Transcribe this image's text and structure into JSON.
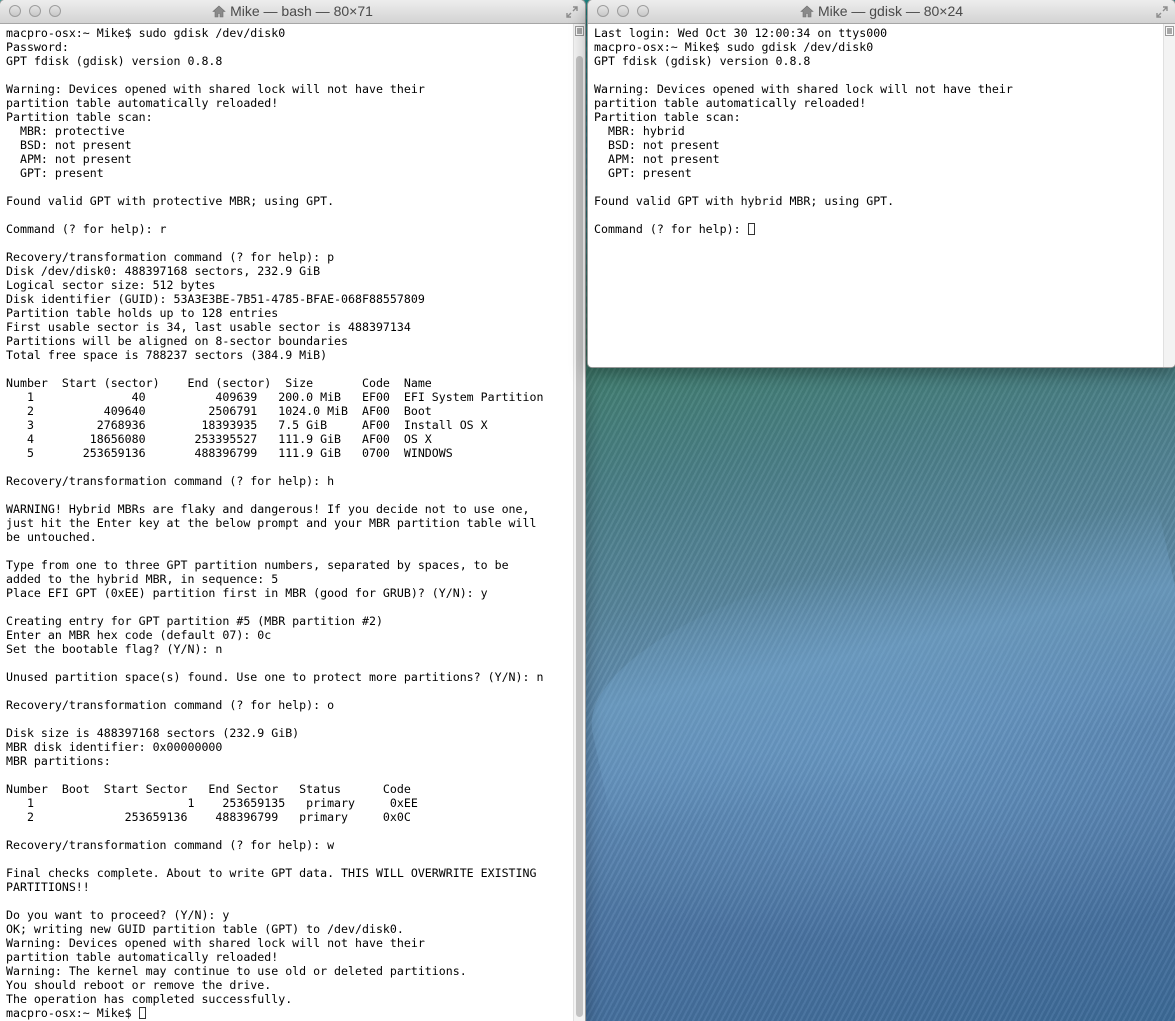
{
  "left_window": {
    "title": "Mike — bash — 80×71",
    "lines": [
      "macpro-osx:~ Mike$ sudo gdisk /dev/disk0",
      "Password:",
      "GPT fdisk (gdisk) version 0.8.8",
      "",
      "Warning: Devices opened with shared lock will not have their",
      "partition table automatically reloaded!",
      "Partition table scan:",
      "  MBR: protective",
      "  BSD: not present",
      "  APM: not present",
      "  GPT: present",
      "",
      "Found valid GPT with protective MBR; using GPT.",
      "",
      "Command (? for help): r",
      "",
      "Recovery/transformation command (? for help): p",
      "Disk /dev/disk0: 488397168 sectors, 232.9 GiB",
      "Logical sector size: 512 bytes",
      "Disk identifier (GUID): 53A3E3BE-7B51-4785-BFAE-068F88557809",
      "Partition table holds up to 128 entries",
      "First usable sector is 34, last usable sector is 488397134",
      "Partitions will be aligned on 8-sector boundaries",
      "Total free space is 788237 sectors (384.9 MiB)",
      "",
      "Number  Start (sector)    End (sector)  Size       Code  Name",
      "   1              40          409639   200.0 MiB   EF00  EFI System Partition",
      "   2          409640         2506791   1024.0 MiB  AF00  Boot",
      "   3         2768936        18393935   7.5 GiB     AF00  Install OS X",
      "   4        18656080       253395527   111.9 GiB   AF00  OS X",
      "   5       253659136       488396799   111.9 GiB   0700  WINDOWS",
      "",
      "Recovery/transformation command (? for help): h",
      "",
      "WARNING! Hybrid MBRs are flaky and dangerous! If you decide not to use one,",
      "just hit the Enter key at the below prompt and your MBR partition table will",
      "be untouched.",
      "",
      "Type from one to three GPT partition numbers, separated by spaces, to be",
      "added to the hybrid MBR, in sequence: 5",
      "Place EFI GPT (0xEE) partition first in MBR (good for GRUB)? (Y/N): y",
      "",
      "Creating entry for GPT partition #5 (MBR partition #2)",
      "Enter an MBR hex code (default 07): 0c",
      "Set the bootable flag? (Y/N): n",
      "",
      "Unused partition space(s) found. Use one to protect more partitions? (Y/N): n",
      "",
      "Recovery/transformation command (? for help): o",
      "",
      "Disk size is 488397168 sectors (232.9 GiB)",
      "MBR disk identifier: 0x00000000",
      "MBR partitions:",
      "",
      "Number  Boot  Start Sector   End Sector   Status      Code",
      "   1                      1    253659135   primary     0xEE",
      "   2             253659136    488396799   primary     0x0C",
      "",
      "Recovery/transformation command (? for help): w",
      "",
      "Final checks complete. About to write GPT data. THIS WILL OVERWRITE EXISTING",
      "PARTITIONS!!",
      "",
      "Do you want to proceed? (Y/N): y",
      "OK; writing new GUID partition table (GPT) to /dev/disk0.",
      "Warning: Devices opened with shared lock will not have their",
      "partition table automatically reloaded!",
      "Warning: The kernel may continue to use old or deleted partitions.",
      "You should reboot or remove the drive.",
      "The operation has completed successfully."
    ],
    "prompt": "macpro-osx:~ Mike$ "
  },
  "right_window": {
    "title": "Mike — gdisk — 80×24",
    "lines": [
      "Last login: Wed Oct 30 12:00:34 on ttys000",
      "macpro-osx:~ Mike$ sudo gdisk /dev/disk0",
      "GPT fdisk (gdisk) version 0.8.8",
      "",
      "Warning: Devices opened with shared lock will not have their",
      "partition table automatically reloaded!",
      "Partition table scan:",
      "  MBR: hybrid",
      "  BSD: not present",
      "  APM: not present",
      "  GPT: present",
      "",
      "Found valid GPT with hybrid MBR; using GPT.",
      ""
    ],
    "prompt": "Command (? for help): "
  },
  "icons": {
    "window_buttons": [
      "close-icon",
      "minimize-icon",
      "zoom-icon"
    ],
    "title": "home-icon",
    "fullscreen": "fullscreen-icon",
    "scroll_menu": "scroll-menu-icon"
  },
  "colors": {
    "terminal_background": "#ffffff",
    "terminal_text": "#000000",
    "titlebar": "#d9d9d9"
  }
}
